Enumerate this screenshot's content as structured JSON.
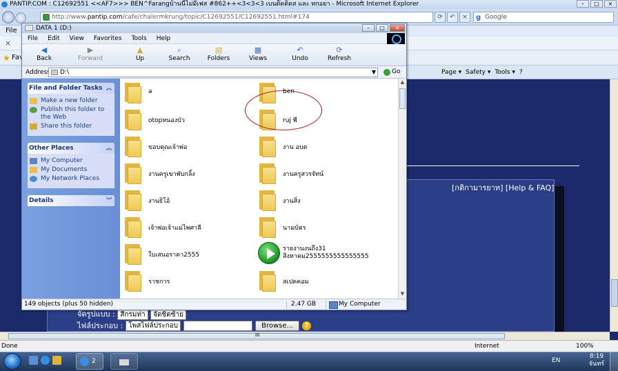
{
  "ie": {
    "title": "PANTIP.COM : C12692551 <<AF7>>> BEN^Farangบ้านนี้ไม่มีเฟส #862++<3<3<3 เบนติ๊ดติ่ดส และ ทกอยา - Microsoft Internet Explorer",
    "title_buttons": [
      "–",
      "□",
      "×"
    ],
    "url_prefix": "http://www.",
    "url_domain": "pantip.com",
    "url_rest": "/cafe/chalermkrung/topic/C12692551/C12692551.html#174",
    "url_buttons": [
      "⟳",
      "↶",
      "×"
    ],
    "search_placeholder": "Google",
    "menu_label": "File",
    "close_x": "×",
    "fav_label": "Fav",
    "cmdbar": [
      "Page ▾",
      "Safety ▾",
      "Tools ▾",
      "?"
    ],
    "status_done": "Done",
    "status_zone": "Internet",
    "status_zoom": "100%",
    "hscroll_grip": "III"
  },
  "page": {
    "help_text": "[กติกามารยาท] [Help & FAQ]",
    "row1_label": "จัดรูปแบบ :",
    "row1_sel1": "สีกรมท่า",
    "row1_sel2": "จัดชิดซ้าย",
    "row2_label": "ไฟล์ประกอบ :",
    "row2_select": "โพสไฟล์ประกอบ",
    "browse_label": "Browse...",
    "help_icon": "?"
  },
  "explorer": {
    "title": "DATA 1 (D:)",
    "win_buttons": [
      "–",
      "□",
      "×"
    ],
    "menu": [
      "File",
      "Edit",
      "View",
      "Favorites",
      "Tools",
      "Help"
    ],
    "toolbar": [
      {
        "label": "Back",
        "icon": "back-icon",
        "glyph": "◀",
        "color": "#2f6fcc"
      },
      {
        "label": "Forward",
        "icon": "forward-icon",
        "glyph": "▶",
        "color": "#8a8a8a"
      },
      {
        "label": "Up",
        "icon": "up-folder-icon",
        "glyph": "▲",
        "color": "#d7a93a"
      },
      {
        "label": "Search",
        "icon": "search-icon",
        "glyph": "⌕",
        "color": "#4a74b4"
      },
      {
        "label": "Folders",
        "icon": "folders-icon",
        "glyph": "▤",
        "color": "#d7a93a"
      },
      {
        "label": "Views",
        "icon": "views-icon",
        "glyph": "▦",
        "color": "#4a74b4"
      },
      {
        "label": "Undo",
        "icon": "undo-icon",
        "glyph": "↶",
        "color": "#2f6fcc"
      },
      {
        "label": "Refresh",
        "icon": "refresh-icon",
        "glyph": "⟳",
        "color": "#4a74b4"
      }
    ],
    "address_label": "Address",
    "address_value": "D:\\",
    "go_label": "Go",
    "tasks": {
      "title": "File and Folder Tasks",
      "items": [
        "Make a new folder",
        "Publish this folder to the Web",
        "Share this folder"
      ]
    },
    "other_places": {
      "title": "Other Places",
      "items": [
        "My Computer",
        "My Documents",
        "My Network Places"
      ]
    },
    "details_title": "Details",
    "items": [
      {
        "name": "a",
        "type": "folder"
      },
      {
        "name": "ben",
        "type": "folder"
      },
      {
        "name": "otopหนองบัว",
        "type": "folder"
      },
      {
        "name": "ruj พี",
        "type": "folder"
      },
      {
        "name": "ขอบคุณเจ้าพ่อ",
        "type": "folder"
      },
      {
        "name": "งาน อบต",
        "type": "folder"
      },
      {
        "name": "งานครูเขาพับกลิ้ง",
        "type": "folder"
      },
      {
        "name": "งานครูสวรจัทน์",
        "type": "folder"
      },
      {
        "name": "งานธิโอ้",
        "type": "folder"
      },
      {
        "name": "งานสิ่ง",
        "type": "folder"
      },
      {
        "name": "เจ้าพ่อเจ้าแม่ไพศาลี",
        "type": "folder"
      },
      {
        "name": "นามบัตร",
        "type": "folder"
      },
      {
        "name": "ใบเสนอราคา2555",
        "type": "folder"
      },
      {
        "name": "รายงานงนถึง31 สิงหาคม2555555555555555",
        "type": "media"
      },
      {
        "name": "ราชการ",
        "type": "folder"
      },
      {
        "name": "สเปคคอม",
        "type": "folder"
      }
    ],
    "status_objects": "149 objects (plus 50 hidden)",
    "status_size": "2.47 GB",
    "status_location": "My Computer"
  },
  "taskbar": {
    "ie_task_count": "2",
    "lang": "EN",
    "time": "8:19",
    "day": "จันทร์"
  }
}
